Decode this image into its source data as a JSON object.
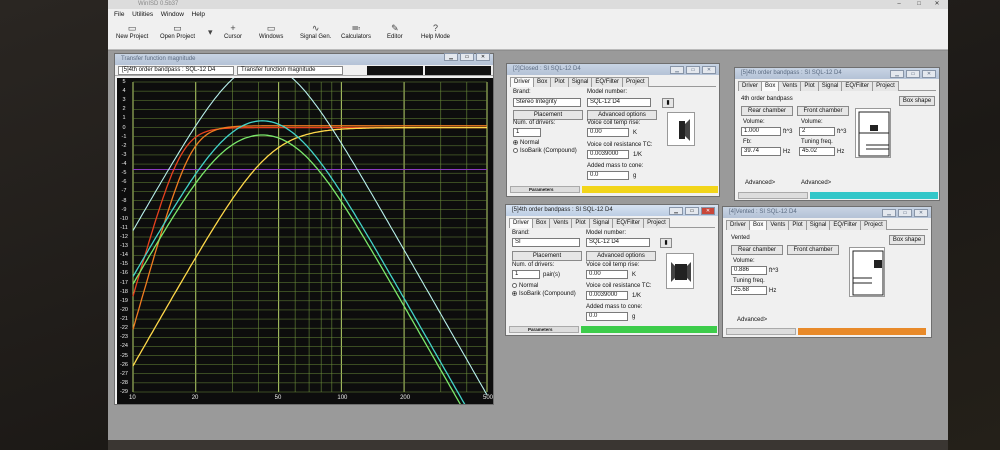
{
  "app": {
    "title": "WinISD 0.5b37",
    "menu": [
      "File",
      "Utilities",
      "Window",
      "Help"
    ],
    "toolbar": [
      {
        "label": "New Project",
        "icon": "new-project-icon"
      },
      {
        "label": "Open Project",
        "icon": "open-project-icon"
      },
      {
        "label": "Cursor",
        "icon": "cursor-icon"
      },
      {
        "label": "Windows",
        "icon": "windows-icon"
      },
      {
        "label": "Signal Gen.",
        "icon": "signal-gen-icon"
      },
      {
        "label": "Calculators",
        "icon": "calculators-icon"
      },
      {
        "label": "Editor",
        "icon": "editor-icon"
      },
      {
        "label": "Help Mode",
        "icon": "help-mode-icon"
      }
    ]
  },
  "graph": {
    "title": "Transfer function magnitude",
    "project_select": "[5]4th order bandpass : SQL-12 D4",
    "plot_select": "Transfer function magnitude",
    "y_ticks": [
      "5",
      "4",
      "3",
      "2",
      "1",
      "0",
      "-1",
      "-2",
      "-3",
      "-4",
      "-5",
      "-6",
      "-7",
      "-8",
      "-9",
      "-10",
      "-11",
      "-12",
      "-13",
      "-14",
      "-15",
      "-16",
      "-17",
      "-18",
      "-19",
      "-20",
      "-21",
      "-22",
      "-23",
      "-24",
      "-25",
      "-26",
      "-27",
      "-28",
      "-29"
    ],
    "x_ticks": [
      "10",
      "20",
      "50",
      "100",
      "200",
      "500"
    ],
    "colors": {
      "bg": "#0d0d0d",
      "grid_minor": "#6a8c3a",
      "grid_major": "#b7d36a",
      "red": "#e8411e",
      "orange": "#f07c20",
      "yellow": "#ffd84a",
      "green": "#7be86b",
      "cyan": "#43d3c8",
      "purple": "#8a3ac0"
    }
  },
  "win_closed": {
    "title": "[2]Closed : SI SQL-12 D4",
    "tabs": [
      "Driver",
      "Box",
      "Plot",
      "Signal",
      "EQ/Filter",
      "Project"
    ],
    "brand_label": "Brand:",
    "brand": "Stereo Integrity",
    "model_label": "Model number:",
    "model": "SQL-12 D4",
    "placement": "Placement",
    "advanced": "Advanced options",
    "num_drivers_label": "Num. of drivers:",
    "num_drivers": "1",
    "vc_temp_label": "Voice coil temp rise:",
    "vc_temp": "0.00",
    "vc_temp_unit": "K",
    "normal": "Normal",
    "isobarik": "IsoBarik (Compound)",
    "vc_res_label": "Voice coil resistance TC:",
    "vc_res": "0.0039000",
    "vc_res_unit": "1/K",
    "mass_label": "Added mass to cone:",
    "mass": "0.0",
    "mass_unit": "g",
    "params": "Parameters",
    "color": "#f2d51a"
  },
  "win_bp_right": {
    "title": "[5]4th order bandpass : SI SQL-12 D4",
    "tabs": [
      "Driver",
      "Box",
      "Vents",
      "Plot",
      "Signal",
      "EQ/Filter",
      "Project"
    ],
    "type": "4th order bandpass",
    "rear": "Rear chamber",
    "front": "Front chamber",
    "box_shape": "Box shape",
    "vol_label": "Volume:",
    "vol_rear": "1.000",
    "vol_front": "2",
    "vol_unit": "ft^3",
    "fb_label": "Fb:",
    "fb": "39.74",
    "fb_unit": "Hz",
    "tuning_label": "Tuning freq.",
    "tuning": "45.02",
    "tuning_unit": "Hz",
    "adv": "Advanced>",
    "color": "#32c7c9"
  },
  "win_bp_driver": {
    "title": "[5]4th order bandpass : SI SQL-12 D4",
    "tabs": [
      "Driver",
      "Box",
      "Vents",
      "Plot",
      "Signal",
      "EQ/Filter",
      "Project"
    ],
    "brand_label": "Brand:",
    "brand": "SI",
    "model_label": "Model number:",
    "model": "SQL-12 D4",
    "placement": "Placement",
    "advanced": "Advanced options",
    "num_drivers_label": "Num. of drivers:",
    "num_drivers": "1",
    "pairs": "pair(s)",
    "vc_temp_label": "Voice coil temp rise:",
    "vc_temp": "0.00",
    "vc_temp_unit": "K",
    "normal": "Normal",
    "isobarik": "IsoBarik (Compound)",
    "vc_res_label": "Voice coil resistance TC:",
    "vc_res": "0.0039000",
    "vc_res_unit": "1/K",
    "mass_label": "Added mass to cone:",
    "mass": "0.0",
    "mass_unit": "g",
    "params": "Parameters",
    "color": "#3ccc4a"
  },
  "win_vented": {
    "title": "[4]Vented : SI SQL-12 D4",
    "tabs": [
      "Driver",
      "Box",
      "Vents",
      "Plot",
      "Signal",
      "EQ/Filter",
      "Project"
    ],
    "type": "Vented",
    "rear": "Rear chamber",
    "front": "Front chamber",
    "box_shape": "Box shape",
    "vol_label": "Volume:",
    "vol": "0.886",
    "vol_unit": "ft^3",
    "tuning_label": "Tuning freq.",
    "tuning": "25.68",
    "tuning_unit": "Hz",
    "adv": "Advanced>",
    "color": "#e88a2a"
  }
}
